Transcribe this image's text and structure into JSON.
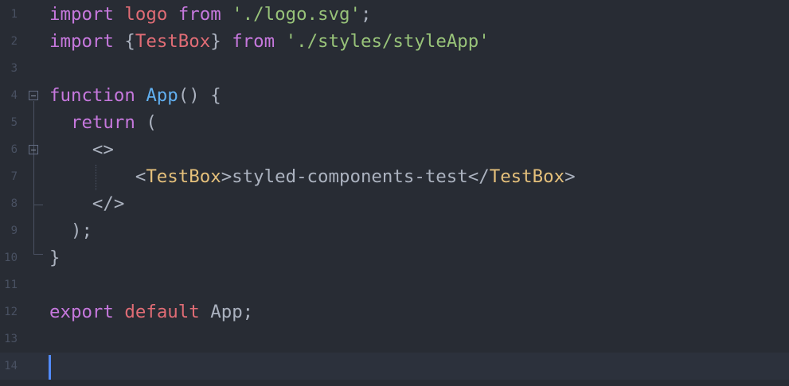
{
  "editor": {
    "lines": [
      {
        "num": "1",
        "tokens": [
          {
            "t": "import",
            "c": "kw"
          },
          {
            "t": " "
          },
          {
            "t": "logo",
            "c": "var"
          },
          {
            "t": " "
          },
          {
            "t": "from",
            "c": "kw"
          },
          {
            "t": " "
          },
          {
            "t": "'./logo.svg'",
            "c": "str"
          },
          {
            "t": ";"
          }
        ]
      },
      {
        "num": "2",
        "tokens": [
          {
            "t": "import",
            "c": "kw"
          },
          {
            "t": " {"
          },
          {
            "t": "TestBox",
            "c": "var"
          },
          {
            "t": "} "
          },
          {
            "t": "from",
            "c": "kw"
          },
          {
            "t": " "
          },
          {
            "t": "'./styles/styleApp'",
            "c": "str"
          }
        ]
      },
      {
        "num": "3",
        "tokens": []
      },
      {
        "num": "4",
        "tokens": [
          {
            "t": "function",
            "c": "kw"
          },
          {
            "t": " "
          },
          {
            "t": "App",
            "c": "fn"
          },
          {
            "t": "() {"
          }
        ]
      },
      {
        "num": "5",
        "tokens": [
          {
            "t": "  "
          },
          {
            "t": "return",
            "c": "kw"
          },
          {
            "t": " ("
          }
        ]
      },
      {
        "num": "6",
        "tokens": [
          {
            "t": "    <>"
          }
        ]
      },
      {
        "num": "7",
        "tokens": [
          {
            "t": "        <"
          },
          {
            "t": "TestBox",
            "c": "tag"
          },
          {
            "t": ">styled-components-test</"
          },
          {
            "t": "TestBox",
            "c": "tag"
          },
          {
            "t": ">"
          }
        ]
      },
      {
        "num": "8",
        "tokens": [
          {
            "t": "    </>"
          }
        ]
      },
      {
        "num": "9",
        "tokens": [
          {
            "t": "  );"
          }
        ]
      },
      {
        "num": "10",
        "tokens": [
          {
            "t": "}"
          }
        ]
      },
      {
        "num": "11",
        "tokens": []
      },
      {
        "num": "12",
        "tokens": [
          {
            "t": "export",
            "c": "kw"
          },
          {
            "t": " "
          },
          {
            "t": "default",
            "c": "var"
          },
          {
            "t": " App;"
          }
        ]
      },
      {
        "num": "13",
        "tokens": []
      },
      {
        "num": "14",
        "tokens": []
      }
    ],
    "current_line": 14
  },
  "colors": {
    "background": "#282c34",
    "keyword": "#c678dd",
    "variable": "#e06c75",
    "string": "#98c379",
    "function": "#61afef",
    "tag": "#e5c07b",
    "text": "#abb2bf",
    "line_number": "#495162",
    "cursor": "#528bff"
  }
}
